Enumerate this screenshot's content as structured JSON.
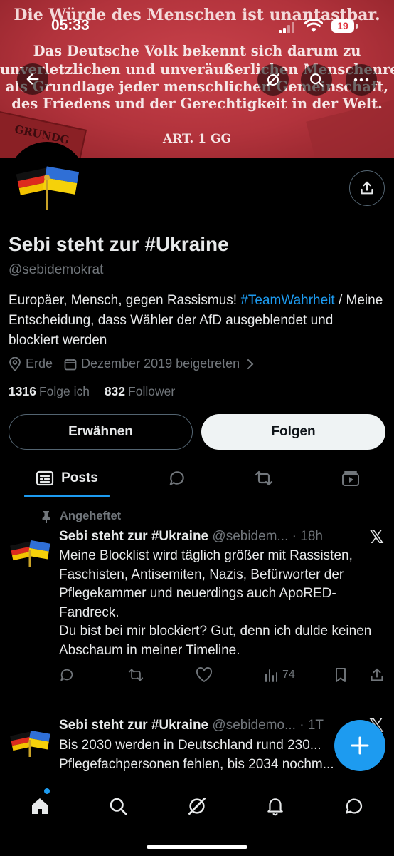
{
  "banner": {
    "line1": "Die Würde des Menschen ist unantastbar.",
    "line2": "Das Deutsche Volk bekennt sich darum zu",
    "line3": "unverletzlichen und unveräußerlichen Menschenrechten",
    "line4": "als Grundlage jeder menschlichen Gemeinschaft,",
    "line5": "des Friedens und der Gerechtigkeit in der Welt.",
    "line6": "ART. 1 GG",
    "book_label": "GRUNDG"
  },
  "status_bar": {
    "time": "05:33",
    "battery": "19"
  },
  "profile": {
    "name": "Sebi steht zur #Ukraine",
    "handle": "@sebidemokrat",
    "bio_part1": "Europäer, Mensch, gegen Rassismus! ",
    "bio_hashtag": "#TeamWahrheit",
    "bio_part2": " / Meine Entscheidung, dass Wähler der AfD ausgeblendet und blockiert werden",
    "location": "Erde",
    "joined": "Dezember 2019 beigetreten",
    "following_count": "1316",
    "following_label": "Folge ich",
    "followers_count": "832",
    "followers_label": "Follower",
    "mention_button": "Erwähnen",
    "follow_button": "Folgen"
  },
  "tabs": {
    "posts": "Posts"
  },
  "tweets": [
    {
      "pinned_label": "Angeheftet",
      "name": "Sebi steht zur #Ukraine",
      "handle": "@sebidem...",
      "time": "· 18h",
      "text": "Meine Blocklist wird täglich größer mit Rassisten, Faschisten, Antisemiten, Nazis, Befürworter der Pflegekammer und neuerdings auch ApoRED-Fandreck.\nDu bist bei mir blockiert? Gut, denn ich dulde keinen Abschaum in meiner Timeline.",
      "views": "74"
    },
    {
      "name": "Sebi steht zur #Ukraine",
      "handle": "@sebidemo...",
      "time": "· 1T",
      "text": "Bis 2030 werden in Deutschland rund 230... Pflegefachpersonen fehlen, bis 2034 nochm..."
    }
  ],
  "colors": {
    "accent": "#1d9bf0",
    "banner_red": "#b2333c",
    "background": "#000000",
    "muted": "#71767b"
  }
}
